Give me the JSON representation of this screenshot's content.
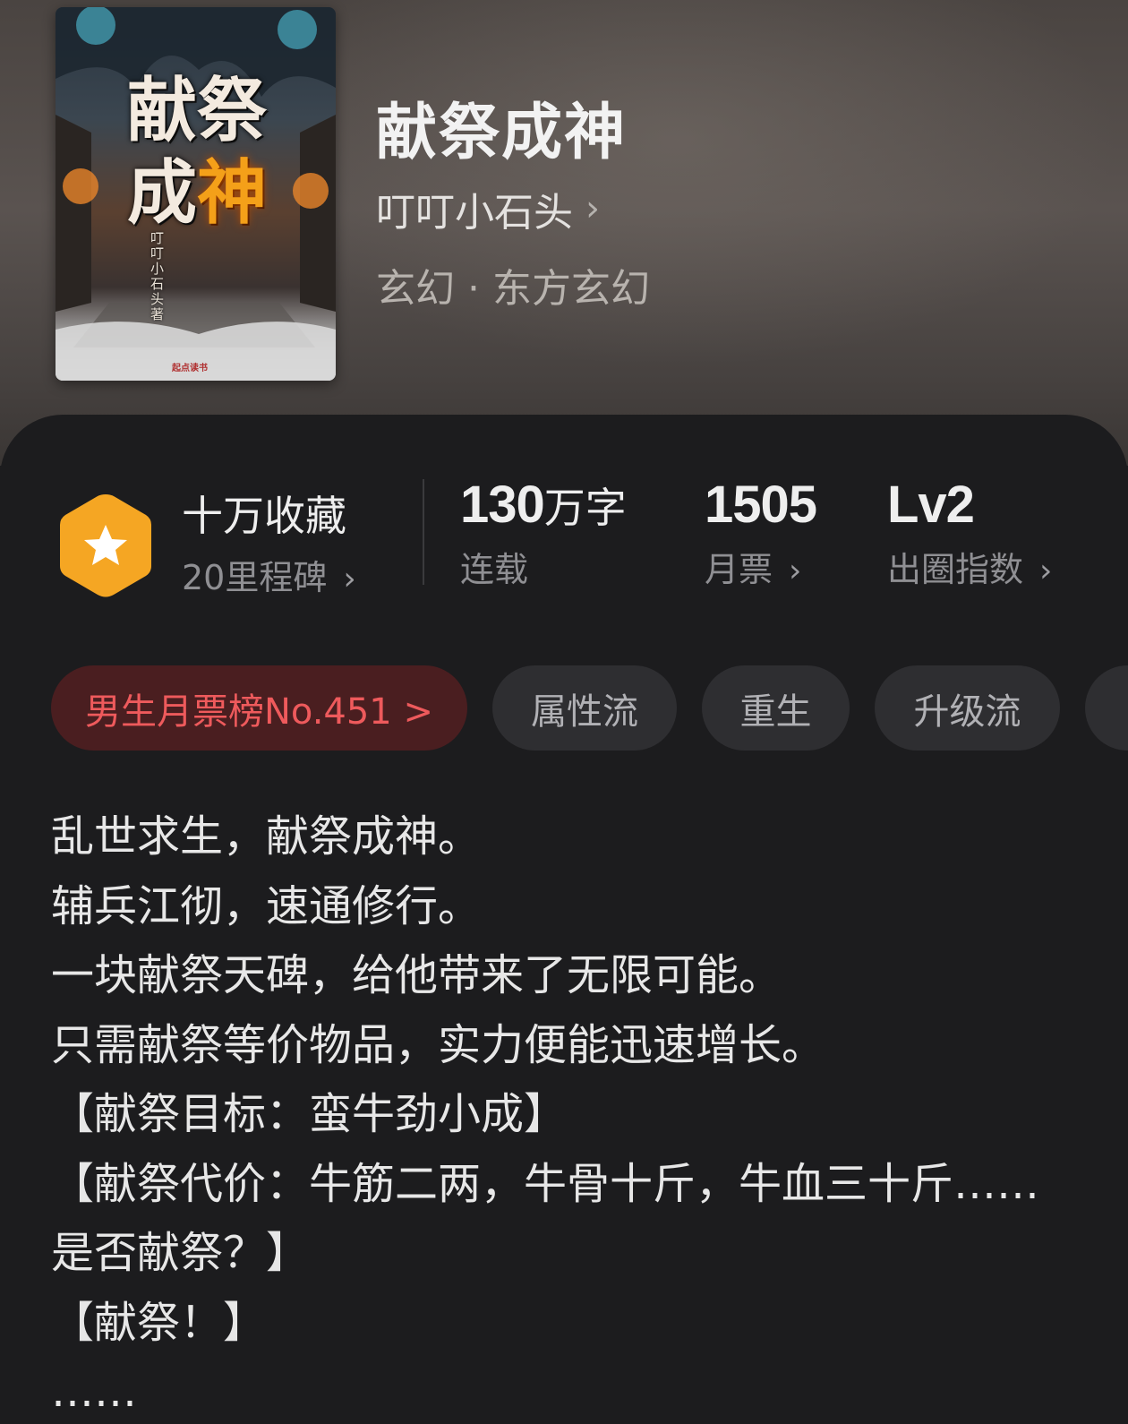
{
  "book": {
    "title": "献祭成神",
    "author": "叮叮小石头",
    "author_chevron": "›",
    "genre": "玄幻 · 东方玄幻"
  },
  "cover": {
    "title_lines": [
      "献",
      "祭",
      "成",
      "神"
    ],
    "author": "叮叮小石头著",
    "publisher": "起点读书"
  },
  "stats": {
    "collect": {
      "label": "十万收藏",
      "sub": "20里程碑",
      "chevron": "›"
    },
    "words": {
      "value": "130",
      "unit": "万字",
      "sub": "连载"
    },
    "monthly": {
      "value": "1505",
      "sub": "月票",
      "chevron": "›"
    },
    "level": {
      "value": "Lv2",
      "sub": "出圈指数",
      "chevron": "›"
    }
  },
  "tags": {
    "rank": "男生月票榜No.451 >",
    "items": [
      "属性流",
      "重生",
      "升级流"
    ]
  },
  "description": [
    "乱世求生，献祭成神。",
    "辅兵江彻，速通修行。",
    "一块献祭天碑，给他带来了无限可能。",
    "只需献祭等价物品，实力便能迅速增长。",
    "【献祭目标：蛮牛劲小成】",
    "【献祭代价：牛筋二两，牛骨十斤，牛血三十斤……",
    "是否献祭？】",
    "【献祭！】",
    "……"
  ],
  "colors": {
    "rank_tag_bg": "#4a1e20",
    "rank_tag_text": "#ee5a5c",
    "badge_orange": "#f5a623",
    "panel_bg": "#1c1c1e"
  }
}
